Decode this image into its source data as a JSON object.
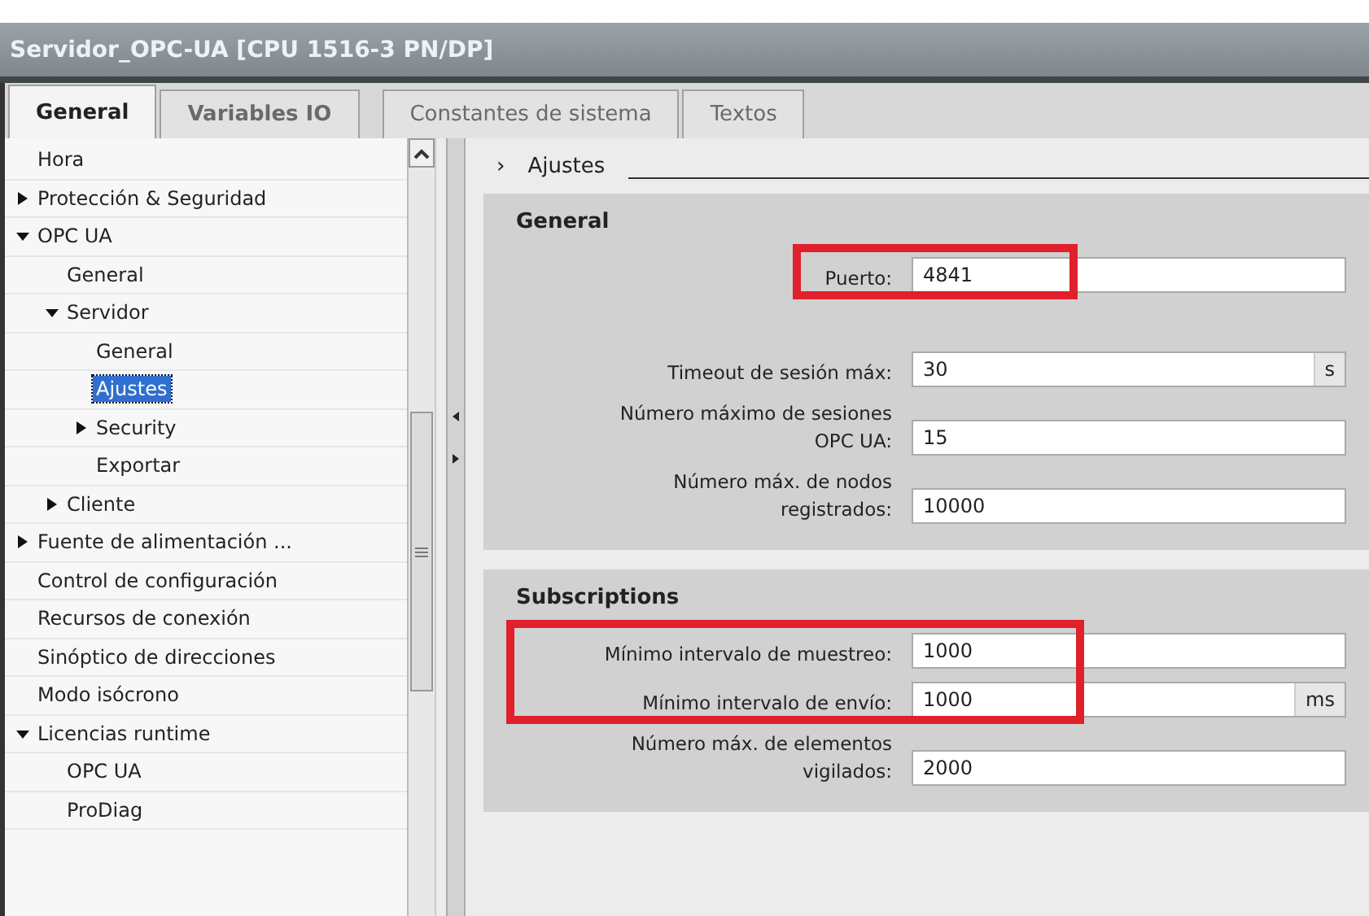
{
  "window": {
    "title": "Servidor_OPC-UA [CPU 1516-3 PN/DP]"
  },
  "tabs": [
    {
      "label": "General",
      "selected": true
    },
    {
      "label": "Variables IO",
      "selected": false
    },
    {
      "label": "Constantes de sistema",
      "selected": false
    },
    {
      "label": "Textos",
      "selected": false
    }
  ],
  "tree": [
    {
      "label": "Hora",
      "selected": false
    },
    {
      "label": "Protección & Seguridad",
      "expanded": false,
      "selected": false
    },
    {
      "label": "OPC UA",
      "expanded": true,
      "selected": false,
      "children": [
        {
          "label": "General",
          "selected": false
        },
        {
          "label": "Servidor",
          "expanded": true,
          "selected": false,
          "children": [
            {
              "label": "General",
              "selected": false
            },
            {
              "label": "Ajustes",
              "selected": true
            },
            {
              "label": "Security",
              "expanded": false,
              "selected": false
            },
            {
              "label": "Exportar",
              "selected": false
            }
          ]
        },
        {
          "label": "Cliente",
          "expanded": false,
          "selected": false
        }
      ]
    },
    {
      "label": "Fuente de alimentación ...",
      "expanded": false,
      "selected": false
    },
    {
      "label": "Control de configuración",
      "selected": false
    },
    {
      "label": "Recursos de conexión",
      "selected": false
    },
    {
      "label": "Sinóptico de direcciones",
      "selected": false
    },
    {
      "label": "Modo isócrono",
      "selected": false
    },
    {
      "label": "Licencias runtime",
      "expanded": true,
      "selected": false,
      "children": [
        {
          "label": "OPC UA",
          "selected": false
        },
        {
          "label": "ProDiag",
          "selected": false
        }
      ]
    }
  ],
  "breadcrumb": {
    "marker": "›",
    "label": "Ajustes"
  },
  "sections": [
    {
      "title": "General",
      "fields": [
        {
          "label": "Puerto:",
          "value": "4841",
          "highlighted": true,
          "gap_before": false
        },
        {
          "label": "Timeout de sesión máx:",
          "value": "30",
          "unit": "s",
          "highlighted": false,
          "gap_before": true
        },
        {
          "label": "Número máximo de sesiones OPC UA:",
          "value": "15",
          "highlighted": false,
          "gap_before": false
        },
        {
          "label": "Número máx. de nodos registrados:",
          "value": "10000",
          "highlighted": false,
          "gap_before": false
        }
      ]
    },
    {
      "title": "Subscriptions",
      "fields": [
        {
          "label": "Mínimo intervalo de muestreo:",
          "value": "1000",
          "highlighted": true,
          "gap_before": false
        },
        {
          "label": "Mínimo intervalo de envío:",
          "value": "1000",
          "unit": "ms",
          "highlighted": true,
          "gap_before": false
        },
        {
          "label": "Número máx. de elementos vigilados:",
          "value": "2000",
          "highlighted": false,
          "gap_before": false
        }
      ]
    }
  ]
}
